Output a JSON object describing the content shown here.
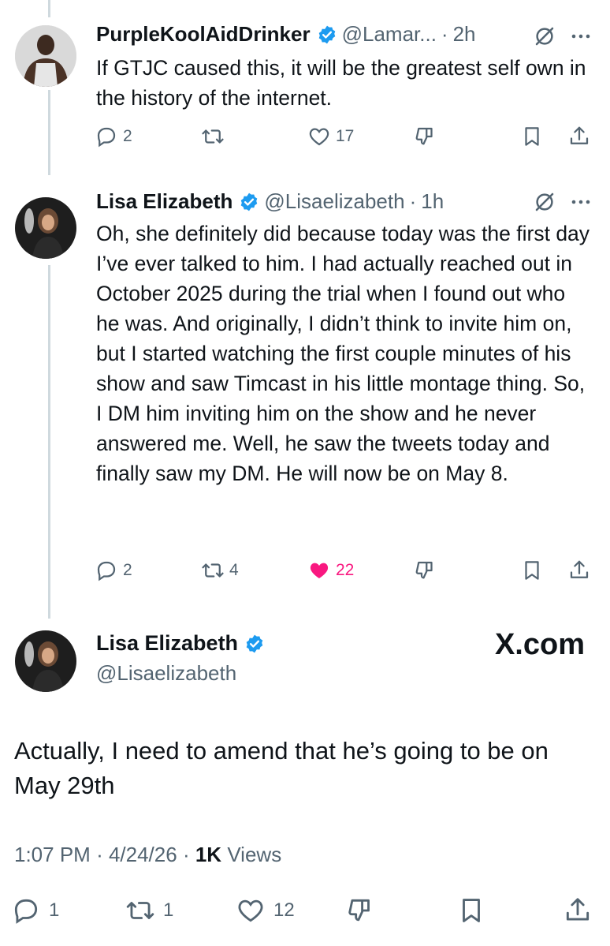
{
  "tweets": [
    {
      "name": "PurpleKoolAidDrinker",
      "handle": "@Lamar...",
      "time": "2h",
      "text": "If GTJC caused this, it will be the greatest self own in the history of the internet.",
      "replies": "2",
      "reposts": "",
      "likes": "17",
      "liked": false
    },
    {
      "name": "Lisa Elizabeth",
      "handle": "@Lisaelizabeth",
      "time": "1h",
      "text": "Oh, she definitely did because today was the first day I’ve ever talked to him. I had actually reached out in October 2025 during the trial when I found out who he was.  And originally, I didn’t think to invite him on, but I started watching the first couple minutes of his show and saw Timcast in his little montage thing. So, I DM him inviting him on the show and he never answered me.  Well, he saw the tweets today and finally saw my DM.  He will now be on May 8.",
      "replies": "2",
      "reposts": "4",
      "likes": "22",
      "liked": true
    }
  ],
  "main": {
    "name": "Lisa Elizabeth",
    "handle": "@Lisaelizabeth",
    "brand": "X.com",
    "text": "Actually, I need to amend that he’s going to be on May 29th",
    "time": "1:07 PM",
    "date": "4/24/26",
    "views_count": "1K",
    "views_label": "Views",
    "replies": "1",
    "reposts": "1",
    "likes": "12"
  },
  "colors": {
    "verified": "#1d9bf0",
    "like": "#f91880",
    "muted": "#536471",
    "text": "#0f1419"
  }
}
